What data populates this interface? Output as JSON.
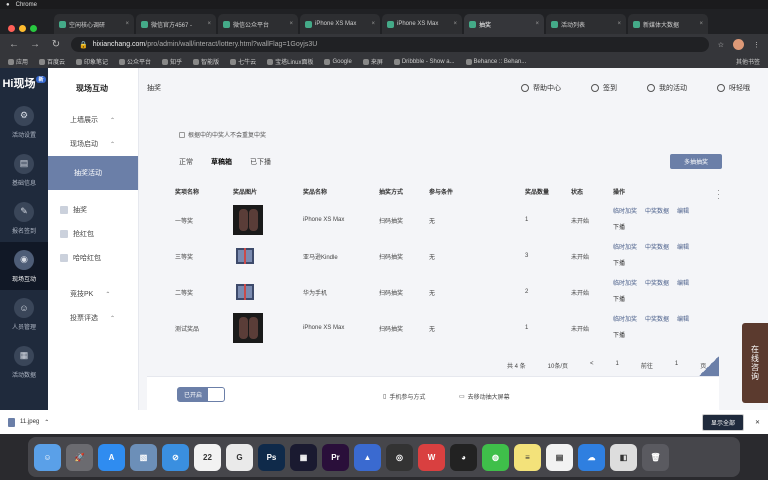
{
  "menubar": {
    "apple": "",
    "app": "Chrome"
  },
  "tabs": [
    {
      "label": "空闲核心调研",
      "active": false
    },
    {
      "label": "微信官方4567 -",
      "active": false
    },
    {
      "label": "微信公众平台",
      "active": false
    },
    {
      "label": "iPhone XS Max",
      "active": false
    },
    {
      "label": "iPhone XS Max",
      "active": false
    },
    {
      "label": "抽奖",
      "active": true
    },
    {
      "label": "活动列表",
      "active": false
    },
    {
      "label": "新媒体大数据",
      "active": false
    }
  ],
  "address": {
    "host": "hixianchang.com",
    "path": "/pro/admin/wall/interact/lottery.html?wallFlag=1Goyjs3U"
  },
  "bookmarks": [
    "应用",
    "百度云",
    "印象笔记",
    "公众平台",
    "知乎",
    "智能版",
    "七牛云",
    "宝塔Linux面板",
    "Google",
    "来屏",
    "Dribbble - Show a...",
    "Behance :: Behan..."
  ],
  "bookmarks_other": "其他书签",
  "logo": {
    "text": "Hi现场",
    "badge": "新"
  },
  "rail": [
    {
      "label": "活动设置",
      "icon": "settings-icon",
      "glyph": "⚙",
      "active": false
    },
    {
      "label": "基础信息",
      "icon": "info-icon",
      "glyph": "▤",
      "active": false
    },
    {
      "label": "报名签到",
      "icon": "checkin-icon",
      "glyph": "✎",
      "active": false
    },
    {
      "label": "现场互动",
      "icon": "interact-icon",
      "glyph": "◉",
      "active": true
    },
    {
      "label": "人员管理",
      "icon": "people-icon",
      "glyph": "☺",
      "active": false
    },
    {
      "label": "活动数据",
      "icon": "data-icon",
      "glyph": "▦",
      "active": false
    }
  ],
  "subnav": {
    "title": "现场互动",
    "items": [
      {
        "label": "上墙展示",
        "chev": "⌃"
      },
      {
        "label": "现场启动",
        "chev": "⌃"
      }
    ],
    "active_label": "抽奖活动",
    "sub_items": [
      "抽奖",
      "抢红包",
      "哈哈红包"
    ],
    "groups": [
      {
        "label": "竞技PK",
        "chev": "⌃"
      },
      {
        "label": "投票评选",
        "chev": "⌃"
      }
    ]
  },
  "topbar": {
    "crumb": "抽奖",
    "help": "帮助中心",
    "checkin": "签到",
    "myevents": "我的活动",
    "user": "呀轻哦"
  },
  "notice": "根据中的中奖人不会重复中奖",
  "filters": [
    "正常",
    "草稿箱",
    "已下播"
  ],
  "active_filter_index": 1,
  "multi_button": "多抽抽奖",
  "table": {
    "headers": [
      "奖项名称",
      "奖品图片",
      "奖品名称",
      "抽奖方式",
      "参与条件",
      "奖品数量",
      "状态",
      "操作"
    ],
    "rows": [
      {
        "name": "一等奖",
        "img": "phone",
        "prize": "iPhone XS Max",
        "method": "扫码抽奖",
        "cond": "无",
        "qty": "1",
        "status": "未开始",
        "ops": [
          "临时加奖",
          "中奖数据",
          "编辑",
          "下播"
        ]
      },
      {
        "name": "三等奖",
        "img": "gift",
        "prize": "亚马逊Kindle",
        "method": "扫码抽奖",
        "cond": "无",
        "qty": "3",
        "status": "未开始",
        "ops": [
          "临时加奖",
          "中奖数据",
          "编辑",
          "下播"
        ]
      },
      {
        "name": "二等奖",
        "img": "gift",
        "prize": "华为手机",
        "method": "扫码抽奖",
        "cond": "无",
        "qty": "2",
        "status": "未开始",
        "ops": [
          "临时加奖",
          "中奖数据",
          "编辑",
          "下播"
        ]
      },
      {
        "name": "测试奖品",
        "img": "phone",
        "prize": "iPhone XS Max",
        "method": "扫码抽奖",
        "cond": "无",
        "qty": "1",
        "status": "未开始",
        "ops": [
          "临时加奖",
          "中奖数据",
          "编辑",
          "下播"
        ]
      }
    ]
  },
  "pager": {
    "total": "共 4 条",
    "per_page": "10条/页",
    "prev": "<",
    "page": "1",
    "goto_label": "前往",
    "goto_value": "1",
    "page_unit": "页"
  },
  "bottombar": {
    "toggle": "已开启",
    "mobile": "手机参与方式",
    "screen": "去移动抽大屏幕"
  },
  "service": "在线咨询",
  "download": {
    "file": "11.jpeg",
    "show_all": "显示全部"
  },
  "dock": [
    {
      "name": "finder-icon",
      "bg": "#5aa0e8",
      "glyph": "☺"
    },
    {
      "name": "launchpad-icon",
      "bg": "#6b6b70",
      "glyph": "🚀"
    },
    {
      "name": "appstore-icon",
      "bg": "#2f8cf0",
      "glyph": "A"
    },
    {
      "name": "preview-icon",
      "bg": "#6c8fb8",
      "glyph": "▧"
    },
    {
      "name": "safari-icon",
      "bg": "#3a8fe0",
      "glyph": "⊘"
    },
    {
      "name": "calendar-icon",
      "bg": "#f2f2f2",
      "glyph": "22"
    },
    {
      "name": "gravit-icon",
      "bg": "#eaeaea",
      "glyph": "G"
    },
    {
      "name": "photoshop-icon",
      "bg": "#0f2a4a",
      "glyph": "Ps"
    },
    {
      "name": "lightroom-icon",
      "bg": "#1a1a30",
      "glyph": "▦"
    },
    {
      "name": "premiere-icon",
      "bg": "#2a0f3a",
      "glyph": "Pr"
    },
    {
      "name": "keynote-icon",
      "bg": "#3a6ad0",
      "glyph": "▲"
    },
    {
      "name": "quicktime-icon",
      "bg": "#333",
      "glyph": "◎"
    },
    {
      "name": "wps-icon",
      "bg": "#d94040",
      "glyph": "W"
    },
    {
      "name": "qq-icon",
      "bg": "#222",
      "glyph": "◕"
    },
    {
      "name": "wechat-icon",
      "bg": "#3fbf4a",
      "glyph": "◍"
    },
    {
      "name": "notes-icon",
      "bg": "#f3e27a",
      "glyph": "≡"
    },
    {
      "name": "pages-icon",
      "bg": "#f2f2f2",
      "glyph": "▤"
    },
    {
      "name": "cloud-icon",
      "bg": "#2f7fe0",
      "glyph": "☁"
    },
    {
      "name": "quicklook-icon",
      "bg": "#ddd",
      "glyph": "◧"
    },
    {
      "name": "trash-icon",
      "bg": "#5a5a60",
      "glyph": "🗑"
    }
  ]
}
